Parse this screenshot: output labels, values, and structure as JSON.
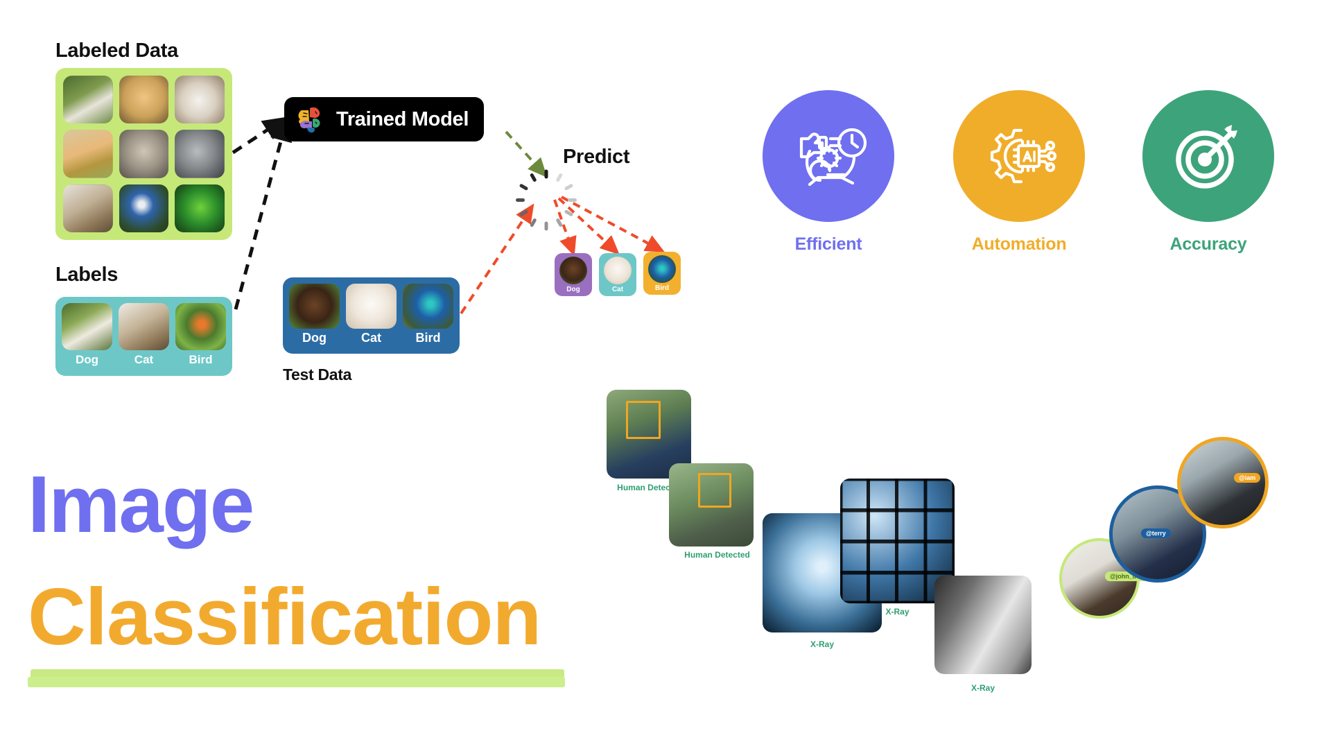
{
  "title": {
    "line1": "Image",
    "line2": "Classification",
    "line1_color": "#6f6ff0",
    "line2_color": "#f2aa2e",
    "underline_color": "#c9e984"
  },
  "pipeline": {
    "labeled_data": {
      "heading": "Labeled Data",
      "panel_color": "#c6e878",
      "items": [
        {
          "alt": "white-dog-photo"
        },
        {
          "alt": "labrador-dog-photo"
        },
        {
          "alt": "white-fluffy-dog-photo"
        },
        {
          "alt": "corgi-dog-photo"
        },
        {
          "alt": "tabby-cat-photo"
        },
        {
          "alt": "grey-cat-photo"
        },
        {
          "alt": "longhair-cat-photo"
        },
        {
          "alt": "blue-bird-photo"
        },
        {
          "alt": "green-parrot-photo"
        }
      ]
    },
    "labels": {
      "heading": "Labels",
      "panel_color": "#6ec7c7",
      "items": [
        {
          "label": "Dog",
          "alt": "white-dog-photo"
        },
        {
          "label": "Cat",
          "alt": "tabby-cat-photo"
        },
        {
          "label": "Bird",
          "alt": "robin-bird-photo"
        }
      ]
    },
    "trained_model": {
      "label": "Trained Model",
      "icon": "brain-icon",
      "background": "#000000"
    },
    "predict": {
      "heading": "Predict",
      "spinner_icon": "loading-spinner-icon"
    },
    "test_data": {
      "heading": "Test Data",
      "panel_color": "#2c6ca5",
      "items": [
        {
          "label": "Dog",
          "alt": "dachshund-puppy-photo"
        },
        {
          "label": "Cat",
          "alt": "white-cat-photo"
        },
        {
          "label": "Bird",
          "alt": "hummingbird-photo"
        }
      ]
    },
    "results": [
      {
        "label": "Dog",
        "color": "#9a6fc0",
        "alt": "dachshund-puppy-photo"
      },
      {
        "label": "Cat",
        "color": "#6ec7c7",
        "alt": "white-cat-photo"
      },
      {
        "label": "Bird",
        "color": "#f2b02e",
        "alt": "hummingbird-photo"
      }
    ]
  },
  "features": [
    {
      "label": "Efficient",
      "color": "#6f6ff0",
      "icon": "efficiency-hand-clock-gear-icon"
    },
    {
      "label": "Automation",
      "color": "#f0ad2a",
      "icon": "gear-ai-chip-icon"
    },
    {
      "label": "Accuracy",
      "color": "#3da37a",
      "icon": "target-arrow-icon"
    }
  ],
  "samples": {
    "caption_color": "#2f9e72",
    "face_box_color": "#f0a622",
    "human": [
      {
        "caption": "Human Detected",
        "alt": "curly-hair-man-photo"
      },
      {
        "caption": "Human Detected",
        "alt": "young-man-backpack-photo"
      }
    ],
    "xray": [
      {
        "caption": "X-Ray",
        "alt": "chest-xray-photo"
      },
      {
        "caption": "X-Ray",
        "alt": "xray-collage-photo"
      },
      {
        "caption": "X-Ray",
        "alt": "neck-spine-xray-photo"
      }
    ],
    "avatars": [
      {
        "tag": "@john_doe",
        "ring": "#c6e878",
        "tag_color": "#c6e878",
        "alt": "man-at-laptop-photo"
      },
      {
        "tag": "@terry",
        "ring": "#1d5f9e",
        "tag_color": "#1d5f9e",
        "alt": "man-on-phone-photo"
      },
      {
        "tag": "@iam",
        "ring": "#f0a622",
        "tag_color": "#f0a622",
        "alt": "man-with-coffee-photo"
      }
    ]
  }
}
